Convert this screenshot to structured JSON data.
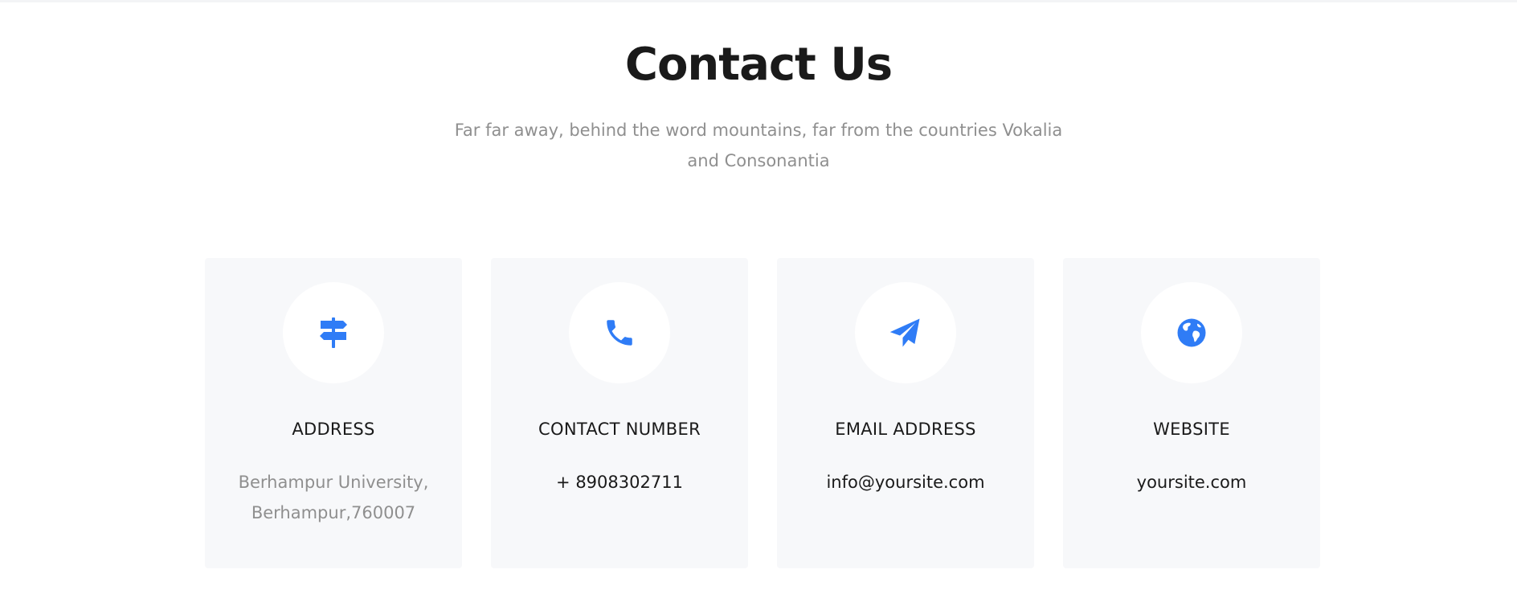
{
  "section": {
    "title": "Contact Us",
    "subtitle": "Far far away, behind the word mountains, far from the countries Vokalia and Consonantia"
  },
  "colors": {
    "accent": "#2f7cf6",
    "card_bg": "#f7f8fa",
    "heading": "#1a1a1a",
    "muted": "#8f8f8f"
  },
  "cards": [
    {
      "icon": "signpost-icon",
      "title": "ADDRESS",
      "value": "Berhampur University, Berhampur,760007"
    },
    {
      "icon": "phone-icon",
      "title": "CONTACT NUMBER",
      "value": "+ 8908302711"
    },
    {
      "icon": "paper-plane-icon",
      "title": "EMAIL ADDRESS",
      "value": "info@yoursite.com"
    },
    {
      "icon": "globe-icon",
      "title": "WEBSITE",
      "value": "yoursite.com"
    }
  ]
}
